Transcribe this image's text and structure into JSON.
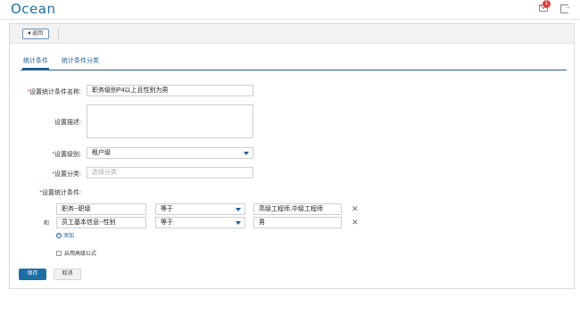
{
  "header": {
    "logo": "Ocean",
    "notification_count": "1",
    "mail_icon": "mail-icon",
    "logout_icon": "logout-icon"
  },
  "toolbar": {
    "back_label": "返回"
  },
  "tabs": [
    {
      "label": "统计条件",
      "active": true
    },
    {
      "label": "统计条件分类",
      "active": false
    }
  ],
  "form": {
    "name": {
      "label": "*设置统计条件名称:",
      "value": "职务级别P4以上且性别为男"
    },
    "description": {
      "label": "设置描述:",
      "value": ""
    },
    "level": {
      "label": "*设置级别:",
      "value": "租户级"
    },
    "category": {
      "label": "*设置分类:",
      "placeholder": "选择分类"
    },
    "conditions_label": "*设置统计条件:",
    "conditions": [
      {
        "connector": "",
        "field": "职务--职级",
        "operator": "等于",
        "value": "高级工程师,中级工程师"
      },
      {
        "connector": "和",
        "field": "员工基本信息--性别",
        "operator": "等于",
        "value": "男"
      }
    ],
    "add_label": "添加",
    "advanced_formula_label": "启用高级公式"
  },
  "actions": {
    "save_label": "保存",
    "cancel_label": "取消"
  },
  "colors": {
    "brand": "#1c6ea4",
    "required": "#d43a2f",
    "badge": "#e0413b"
  }
}
